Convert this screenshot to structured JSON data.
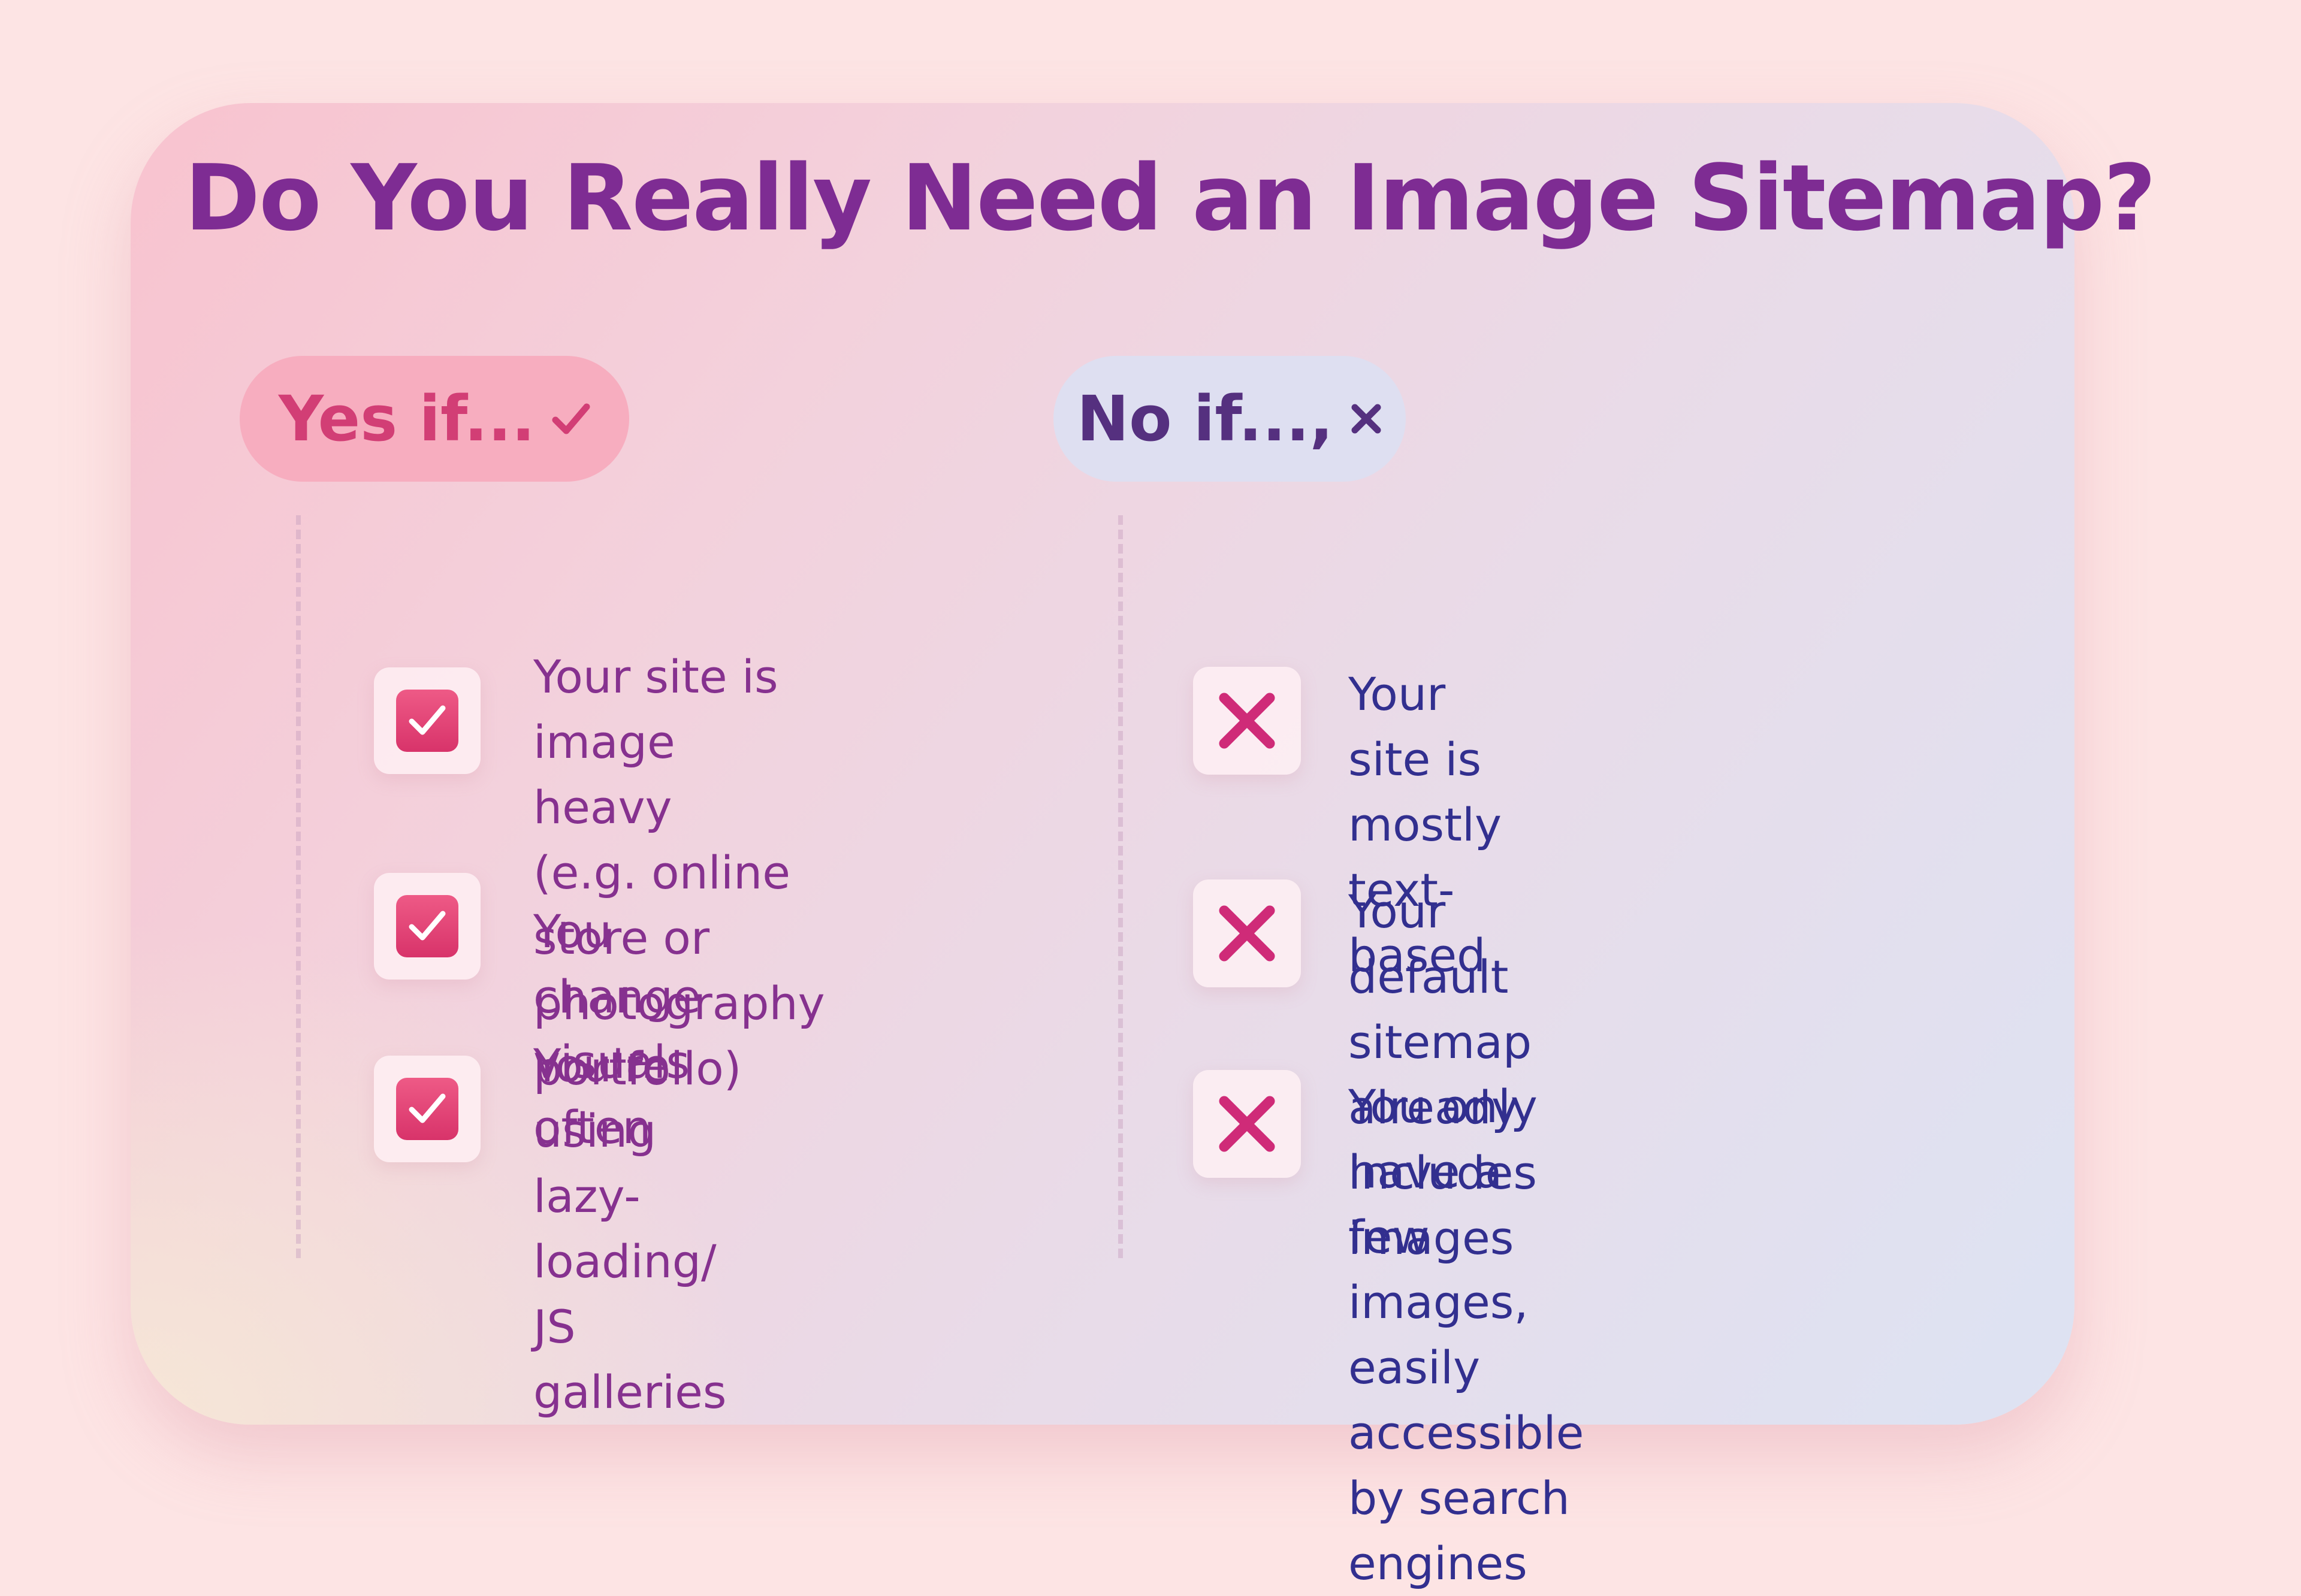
{
  "page": {
    "title": "Do You Really Need an Image Sitemap?",
    "background_color": "#fde4e4",
    "accent_color": "#d23e75",
    "title_color": "#7e2c93"
  },
  "yes_column": {
    "heading": "Yes if...",
    "heading_icon": "checkmark-icon",
    "item_icon": "checked-checkbox-icon",
    "items": [
      {
        "text_lines": [
          "Your site is image heavy",
          "(e.g. online store or",
          "photography portfollo)"
        ]
      },
      {
        "text_lines": [
          "You change visuals often"
        ]
      },
      {
        "text_lines": [
          "You're using lazy-loading/",
          "JS galleries"
        ]
      }
    ]
  },
  "no_column": {
    "heading": "No if...,",
    "heading_icon": "cross-icon",
    "item_icon": "cross-icon",
    "items": [
      {
        "text_lines": [
          "Your site is mostly",
          "text-based"
        ]
      },
      {
        "text_lines": [
          "Your default sitemap already",
          "includes images"
        ]
      },
      {
        "text_lines": [
          "You only have a few images,",
          "easily accessible by search",
          "engines"
        ]
      }
    ]
  }
}
